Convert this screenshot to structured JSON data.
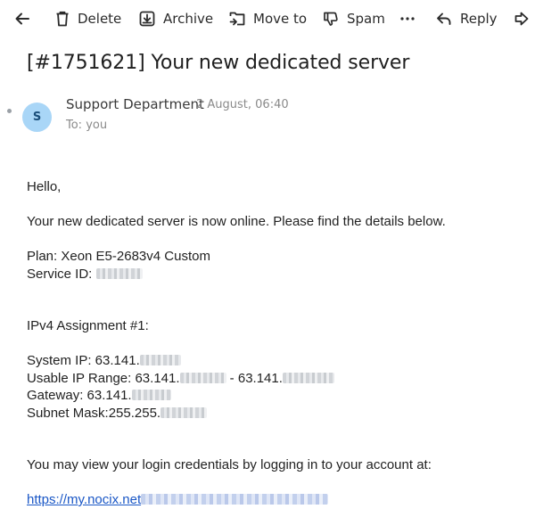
{
  "toolbar": {
    "back_icon": "arrow-left-icon",
    "delete": {
      "label": "Delete",
      "icon": "trash-icon"
    },
    "archive": {
      "label": "Archive",
      "icon": "archive-icon"
    },
    "move": {
      "label": "Move to",
      "icon": "move-to-folder-icon"
    },
    "spam": {
      "label": "Spam",
      "icon": "thumbs-down-icon"
    },
    "more_icon": "more-horizontal-icon",
    "reply": {
      "label": "Reply",
      "icon": "reply-icon"
    },
    "forward_icon": "forward-icon"
  },
  "message": {
    "subject": "[#1751621] Your new dedicated server",
    "sender": {
      "avatar_letter": "S",
      "avatar_color": "#a9d6f7",
      "name": "Support Department",
      "date": "2 August, 06:40",
      "to": "To: you"
    },
    "body": {
      "greeting": "Hello,",
      "intro": "Your new dedicated server is now online. Please find the details below.",
      "plan": "Plan: Xeon E5-2683v4 Custom",
      "service_id_label": "Service ID:",
      "ipv4_heading": "IPv4 Assignment #1:",
      "system_ip_label": "System IP: 63.141.",
      "usable_range_label": "Usable IP Range: 63.141.",
      "usable_range_sep": " - 63.141.",
      "gateway_label": "Gateway: 63.141.",
      "subnet_label": "Subnet Mask:255.255.",
      "credentials_text": "You may view your login credentials by logging in to your account at:",
      "link_text": "https://my.nocix.net"
    }
  },
  "colors": {
    "link": "#1a57c6",
    "muted": "#8a8a8a",
    "text": "#222222"
  }
}
